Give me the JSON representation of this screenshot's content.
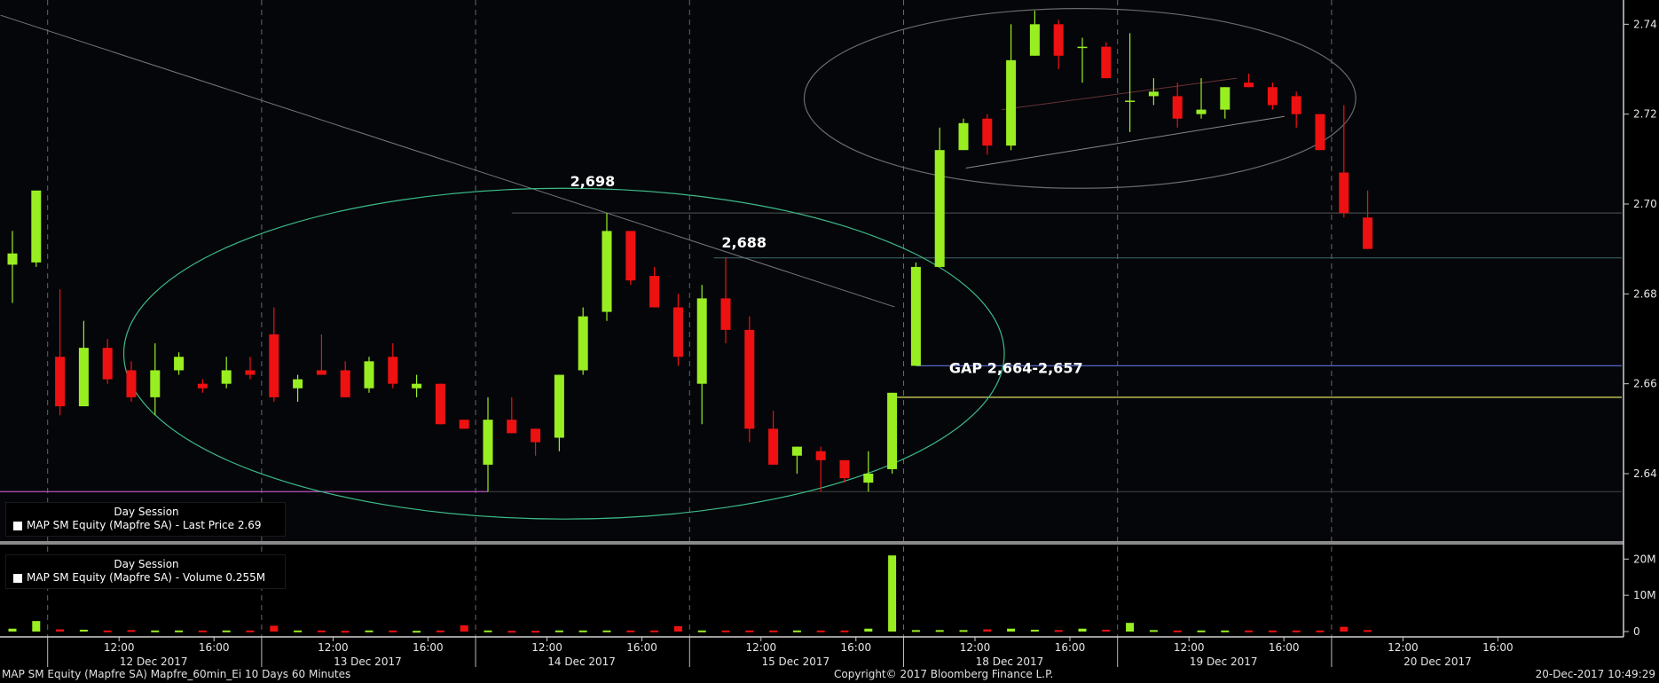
{
  "chart_data": {
    "type": "candlestick",
    "price_axis": {
      "ylim": [
        2.625,
        2.745
      ],
      "ticks": [
        2.64,
        2.66,
        2.68,
        2.7,
        2.72,
        2.74
      ],
      "tick_labels": [
        "2.64",
        "2.66",
        "2.68",
        "2.70",
        "2.72",
        "2.74"
      ]
    },
    "volume_axis": {
      "ylim": [
        0,
        23
      ],
      "ticks": [
        0,
        10,
        20
      ],
      "tick_labels": [
        "0",
        "10M",
        "20M"
      ]
    },
    "candles": [
      {
        "o": 2.6865,
        "h": 2.694,
        "l": 2.678,
        "c": 2.689
      },
      {
        "o": 2.687,
        "h": 2.703,
        "l": 2.686,
        "c": 2.703
      },
      {
        "o": 2.666,
        "h": 2.681,
        "l": 2.653,
        "c": 2.655
      },
      {
        "o": 2.655,
        "h": 2.674,
        "l": 2.655,
        "c": 2.668
      },
      {
        "o": 2.668,
        "h": 2.67,
        "l": 2.66,
        "c": 2.661
      },
      {
        "o": 2.663,
        "h": 2.665,
        "l": 2.656,
        "c": 2.657
      },
      {
        "o": 2.657,
        "h": 2.669,
        "l": 2.653,
        "c": 2.663
      },
      {
        "o": 2.663,
        "h": 2.667,
        "l": 2.662,
        "c": 2.666
      },
      {
        "o": 2.66,
        "h": 2.661,
        "l": 2.658,
        "c": 2.659
      },
      {
        "o": 2.66,
        "h": 2.666,
        "l": 2.659,
        "c": 2.663
      },
      {
        "o": 2.663,
        "h": 2.666,
        "l": 2.661,
        "c": 2.662
      },
      {
        "o": 2.671,
        "h": 2.677,
        "l": 2.656,
        "c": 2.657
      },
      {
        "o": 2.659,
        "h": 2.662,
        "l": 2.656,
        "c": 2.661
      },
      {
        "o": 2.663,
        "h": 2.671,
        "l": 2.662,
        "c": 2.662
      },
      {
        "o": 2.663,
        "h": 2.665,
        "l": 2.657,
        "c": 2.657
      },
      {
        "o": 2.659,
        "h": 2.666,
        "l": 2.658,
        "c": 2.665
      },
      {
        "o": 2.666,
        "h": 2.669,
        "l": 2.659,
        "c": 2.66
      },
      {
        "o": 2.659,
        "h": 2.662,
        "l": 2.657,
        "c": 2.66
      },
      {
        "o": 2.66,
        "h": 2.66,
        "l": 2.651,
        "c": 2.651
      },
      {
        "o": 2.652,
        "h": 2.652,
        "l": 2.65,
        "c": 2.65
      },
      {
        "o": 2.642,
        "h": 2.657,
        "l": 2.636,
        "c": 2.652
      },
      {
        "o": 2.652,
        "h": 2.657,
        "l": 2.649,
        "c": 2.649
      },
      {
        "o": 2.65,
        "h": 2.65,
        "l": 2.644,
        "c": 2.647
      },
      {
        "o": 2.648,
        "h": 2.662,
        "l": 2.645,
        "c": 2.662
      },
      {
        "o": 2.663,
        "h": 2.677,
        "l": 2.662,
        "c": 2.675
      },
      {
        "o": 2.676,
        "h": 2.698,
        "l": 2.674,
        "c": 2.694
      },
      {
        "o": 2.694,
        "h": 2.694,
        "l": 2.682,
        "c": 2.683
      },
      {
        "o": 2.684,
        "h": 2.686,
        "l": 2.677,
        "c": 2.677
      },
      {
        "o": 2.677,
        "h": 2.68,
        "l": 2.664,
        "c": 2.666
      },
      {
        "o": 2.66,
        "h": 2.682,
        "l": 2.651,
        "c": 2.679
      },
      {
        "o": 2.679,
        "h": 2.688,
        "l": 2.669,
        "c": 2.672
      },
      {
        "o": 2.672,
        "h": 2.675,
        "l": 2.647,
        "c": 2.65
      },
      {
        "o": 2.65,
        "h": 2.654,
        "l": 2.642,
        "c": 2.642
      },
      {
        "o": 2.644,
        "h": 2.646,
        "l": 2.64,
        "c": 2.646
      },
      {
        "o": 2.645,
        "h": 2.646,
        "l": 2.636,
        "c": 2.643
      },
      {
        "o": 2.643,
        "h": 2.643,
        "l": 2.638,
        "c": 2.639
      },
      {
        "o": 2.638,
        "h": 2.645,
        "l": 2.636,
        "c": 2.64
      },
      {
        "o": 2.641,
        "h": 2.658,
        "l": 2.64,
        "c": 2.658
      },
      {
        "o": 2.664,
        "h": 2.687,
        "l": 2.664,
        "c": 2.686
      },
      {
        "o": 2.686,
        "h": 2.717,
        "l": 2.686,
        "c": 2.712
      },
      {
        "o": 2.712,
        "h": 2.719,
        "l": 2.712,
        "c": 2.718
      },
      {
        "o": 2.719,
        "h": 2.72,
        "l": 2.711,
        "c": 2.713
      },
      {
        "o": 2.713,
        "h": 2.74,
        "l": 2.712,
        "c": 2.732
      },
      {
        "o": 2.733,
        "h": 2.743,
        "l": 2.733,
        "c": 2.74
      },
      {
        "o": 2.74,
        "h": 2.741,
        "l": 2.73,
        "c": 2.733
      },
      {
        "o": 2.735,
        "h": 2.737,
        "l": 2.727,
        "c": 2.735
      },
      {
        "o": 2.735,
        "h": 2.736,
        "l": 2.728,
        "c": 2.728
      },
      {
        "o": 2.723,
        "h": 2.738,
        "l": 2.716,
        "c": 2.723
      },
      {
        "o": 2.724,
        "h": 2.728,
        "l": 2.722,
        "c": 2.725
      },
      {
        "o": 2.724,
        "h": 2.727,
        "l": 2.717,
        "c": 2.719
      },
      {
        "o": 2.72,
        "h": 2.728,
        "l": 2.719,
        "c": 2.721
      },
      {
        "o": 2.721,
        "h": 2.726,
        "l": 2.719,
        "c": 2.726
      },
      {
        "o": 2.727,
        "h": 2.729,
        "l": 2.726,
        "c": 2.726
      },
      {
        "o": 2.726,
        "h": 2.727,
        "l": 2.721,
        "c": 2.722
      },
      {
        "o": 2.724,
        "h": 2.725,
        "l": 2.717,
        "c": 2.72
      },
      {
        "o": 2.72,
        "h": 2.72,
        "l": 2.712,
        "c": 2.712
      },
      {
        "o": 2.707,
        "h": 2.722,
        "l": 2.697,
        "c": 2.698
      },
      {
        "o": 2.697,
        "h": 2.703,
        "l": 2.69,
        "c": 2.69
      }
    ],
    "volumes": [
      0.8,
      2.9,
      0.6,
      0.5,
      0.3,
      0.4,
      0.3,
      0.3,
      0.3,
      0.3,
      0.3,
      1.6,
      0.3,
      0.3,
      0.2,
      0.3,
      0.3,
      0.2,
      0.3,
      1.7,
      0.3,
      0.2,
      0.2,
      0.3,
      0.3,
      0.3,
      0.3,
      0.3,
      1.5,
      0.3,
      0.3,
      0.3,
      0.3,
      0.3,
      0.3,
      0.3,
      0.8,
      21.0,
      0.4,
      0.4,
      0.4,
      0.6,
      0.8,
      0.5,
      0.4,
      0.8,
      0.5,
      2.4,
      0.4,
      0.3,
      0.3,
      0.3,
      0.3,
      0.3,
      0.3,
      0.3,
      1.3,
      0.4
    ],
    "x_ticks_time": [
      "12:00",
      "16:00",
      "12:00",
      "16:00",
      "12:00",
      "16:00",
      "12:00",
      "16:00",
      "12:00",
      "16:00",
      "12:00",
      "16:00",
      "12:00",
      "16:00"
    ],
    "x_ticks_date": [
      "12 Dec 2017",
      "13 Dec 2017",
      "14 Dec 2017",
      "15 Dec 2017",
      "18 Dec 2017",
      "19 Dec 2017",
      "20 Dec 2017"
    ],
    "annotations": {
      "level_2698": "2,698",
      "level_2688": "2,688",
      "gap": "GAP 2,664-2,657"
    },
    "reference_levels": [
      2.698,
      2.688,
      2.664,
      2.657,
      2.636
    ],
    "colors": {
      "up": "#99ee22",
      "down": "#ee1111",
      "ellipse_green": "#3dbb88",
      "ellipse_grey": "#777777",
      "gap_top_line": "#5566cc",
      "gap_bottom_line": "#dddd66",
      "support_line": "#bb55bb"
    }
  },
  "legend": {
    "price": {
      "session": "Day Session",
      "label": "MAP SM Equity (Mapfre SA) - Last Price 2.69"
    },
    "volume": {
      "session": "Day Session",
      "label": "MAP SM Equity (Mapfre SA) - Volume 0.255M"
    }
  },
  "footer": {
    "left": "MAP SM Equity (Mapfre SA) Mapfre_60min_Ei 10 Days 60 Minutes",
    "middle": "Copyright© 2017 Bloomberg Finance L.P.",
    "right": "20-Dec-2017 10:49:29"
  }
}
